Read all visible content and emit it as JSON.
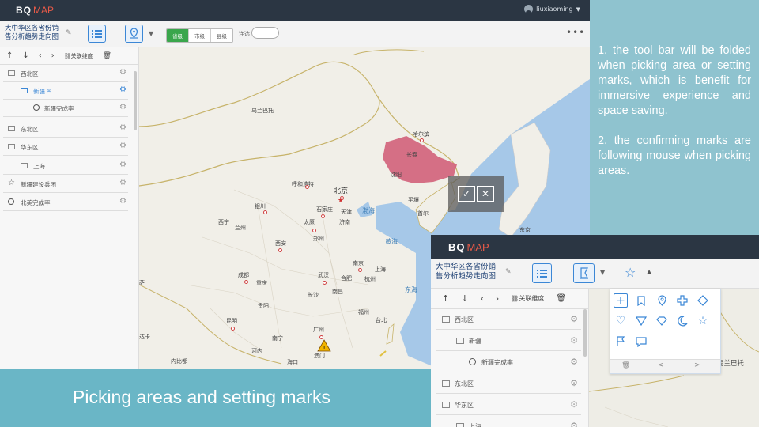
{
  "app": {
    "logo_text": "BQ",
    "logo_sub": "MAP",
    "username": "liuxiaoming"
  },
  "report": {
    "title_line1": "大中华区各省份销",
    "title_line2": "售分析趋势走向图"
  },
  "toolbar": {
    "levels": [
      "省级",
      "市级",
      "县级"
    ],
    "active_level": "省级",
    "link_label": "连选"
  },
  "sidebar": {
    "related_dim": "关联维度",
    "items": [
      {
        "label": "西北区",
        "type": "layer"
      },
      {
        "label": "新疆",
        "type": "layer",
        "selected": true
      },
      {
        "label": "新疆完成率",
        "type": "circle"
      },
      {
        "label": "东北区",
        "type": "layer"
      },
      {
        "label": "华东区",
        "type": "layer"
      },
      {
        "label": "上海",
        "type": "layer"
      },
      {
        "label": "新疆建设兵团",
        "type": "star"
      },
      {
        "label": "北美完成率",
        "type": "circle"
      }
    ]
  },
  "map": {
    "labels": {
      "mongolia": "乌兰巴托",
      "harbin": "哈尔滨",
      "changchun": "长春",
      "shenyang": "沈阳",
      "hohhot": "呼和浩特",
      "beijing": "北京",
      "tianjin": "天津",
      "shijiazhuang": "石家庄",
      "pyongyang": "平壤",
      "seoul": "首尔",
      "bohai": "渤海",
      "yinchuan": "银川",
      "taiyuan": "太原",
      "jinan": "济南",
      "xining": "西宁",
      "lanzhou": "兰州",
      "zhengzhou": "郑州",
      "yellow_sea": "黄海",
      "xian": "西安",
      "nanjing": "南京",
      "shanghai": "上海",
      "chengdu": "成都",
      "chongqing": "重庆",
      "wuhan": "武汉",
      "hefei": "合肥",
      "hangzhou": "杭州",
      "east_sea": "东海",
      "changsha": "长沙",
      "nanchang": "南昌",
      "guiyang": "贵阳",
      "fuzhou": "福州",
      "taipei": "台北",
      "kunming": "昆明",
      "nanning": "南宁",
      "guangzhou": "广州",
      "macau": "澳门",
      "hanoi": "河内",
      "naypyidaw": "内比都",
      "haikou": "海口",
      "tokyo": "东京",
      "lhasa": "萨",
      "dhaka": "达卡",
      "guanzhou": "关州"
    },
    "highlight_region": "长春",
    "copyright": "©2012-0001号 - Data ©"
  },
  "confirm": {
    "ok": "✓",
    "cancel": "✕"
  },
  "caption": "Picking areas and setting marks",
  "notes": [
    "1, the tool bar will be folded when picking area or setting marks, which is benefit for immersive experience and space saving.",
    "2, the confirming marks are following mouse when picking areas."
  ],
  "inset": {
    "related_dim": "关联维度",
    "items": [
      {
        "label": "西北区"
      },
      {
        "label": "新疆"
      },
      {
        "label": "新疆完成率"
      },
      {
        "label": "东北区"
      },
      {
        "label": "华东区"
      },
      {
        "label": "上海"
      }
    ],
    "map_label": "乌兰巴托",
    "map_label2": "巴托"
  },
  "colors": {
    "topbar": "#2b3643",
    "accent": "#3b87d6",
    "highlight": "#d2607a",
    "caption": "#6ab6c6",
    "panel_bg": "#8fc3cf"
  }
}
